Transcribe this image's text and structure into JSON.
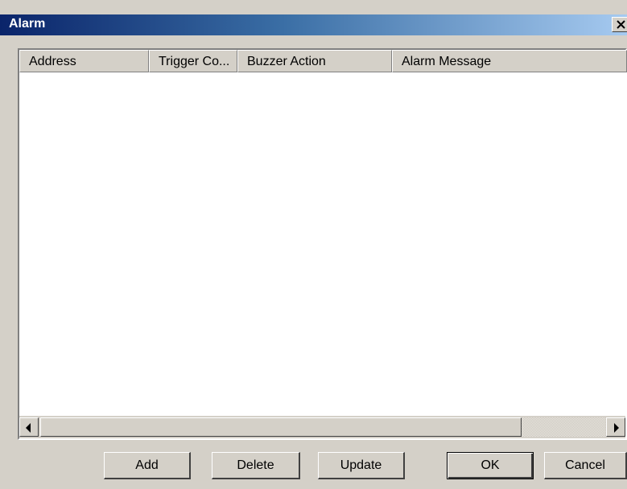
{
  "window": {
    "title": "Alarm",
    "close_icon": "close-icon"
  },
  "listview": {
    "columns": [
      {
        "label": "Address"
      },
      {
        "label": "Trigger Co..."
      },
      {
        "label": "Buzzer Action"
      },
      {
        "label": "Alarm Message"
      }
    ],
    "rows": []
  },
  "scrollbar": {
    "left_icon": "arrow-left-icon",
    "right_icon": "arrow-right-icon"
  },
  "buttons": {
    "add": "Add",
    "delete": "Delete",
    "update": "Update",
    "ok": "OK",
    "cancel": "Cancel"
  },
  "colors": {
    "titlebar_start": "#0a246a",
    "titlebar_end": "#a6caf0",
    "face": "#d4d0c8"
  }
}
